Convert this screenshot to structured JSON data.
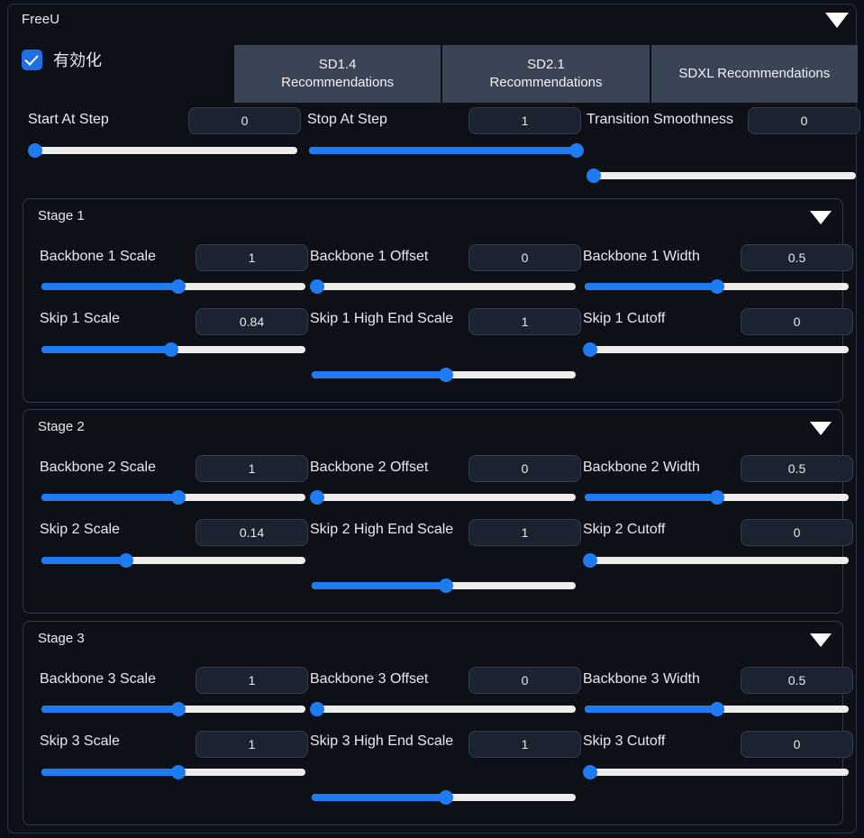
{
  "accordion": {
    "title": "FreeU",
    "collapse_icon": "chevron-down-icon"
  },
  "enable": {
    "label": "有効化",
    "checked": true
  },
  "tabs": [
    {
      "line1": "SD1.4",
      "line2": "Recommendations"
    },
    {
      "line1": "SD2.1",
      "line2": "Recommendations"
    },
    {
      "line1": "SDXL Recommendations",
      "line2": ""
    }
  ],
  "top_controls": [
    {
      "label": "Start At Step",
      "value": "0",
      "percent": 2
    },
    {
      "label": "Stop At Step",
      "value": "1",
      "percent": 100
    },
    {
      "label": "Transition Smoothness",
      "value": "0",
      "percent": 2
    }
  ],
  "stages": [
    {
      "title": "Stage 1",
      "collapse_icon": "chevron-down-icon",
      "controls": [
        {
          "label": "Backbone 1 Scale",
          "value": "1",
          "percent": 52
        },
        {
          "label": "Backbone 1 Offset",
          "value": "0",
          "percent": 2
        },
        {
          "label": "Backbone 1 Width",
          "value": "0.5",
          "percent": 50
        },
        {
          "label": "Skip 1 Scale",
          "value": "0.84",
          "percent": 49
        },
        {
          "label": "Skip 1 High End Scale",
          "value": "1",
          "percent": 51
        },
        {
          "label": "Skip 1 Cutoff",
          "value": "0",
          "percent": 2
        }
      ]
    },
    {
      "title": "Stage 2",
      "collapse_icon": "chevron-down-icon",
      "controls": [
        {
          "label": "Backbone 2 Scale",
          "value": "1",
          "percent": 52
        },
        {
          "label": "Backbone 2 Offset",
          "value": "0",
          "percent": 2
        },
        {
          "label": "Backbone 2 Width",
          "value": "0.5",
          "percent": 50
        },
        {
          "label": "Skip 2 Scale",
          "value": "0.14",
          "percent": 32
        },
        {
          "label": "Skip 2 High End Scale",
          "value": "1",
          "percent": 51
        },
        {
          "label": "Skip 2 Cutoff",
          "value": "0",
          "percent": 2
        }
      ]
    },
    {
      "title": "Stage 3",
      "collapse_icon": "chevron-down-icon",
      "controls": [
        {
          "label": "Backbone 3 Scale",
          "value": "1",
          "percent": 52
        },
        {
          "label": "Backbone 3 Offset",
          "value": "0",
          "percent": 2
        },
        {
          "label": "Backbone 3 Width",
          "value": "0.5",
          "percent": 50
        },
        {
          "label": "Skip 3 Scale",
          "value": "1",
          "percent": 52
        },
        {
          "label": "Skip 3 High End Scale",
          "value": "1",
          "percent": 51
        },
        {
          "label": "Skip 3 Cutoff",
          "value": "0",
          "percent": 2
        }
      ]
    }
  ],
  "colors": {
    "accent": "#1f7bf2",
    "panel_bg": "#0d1117",
    "tab_bg": "#3b4455",
    "track": "#ededeb",
    "text": "#e7e9ee"
  }
}
